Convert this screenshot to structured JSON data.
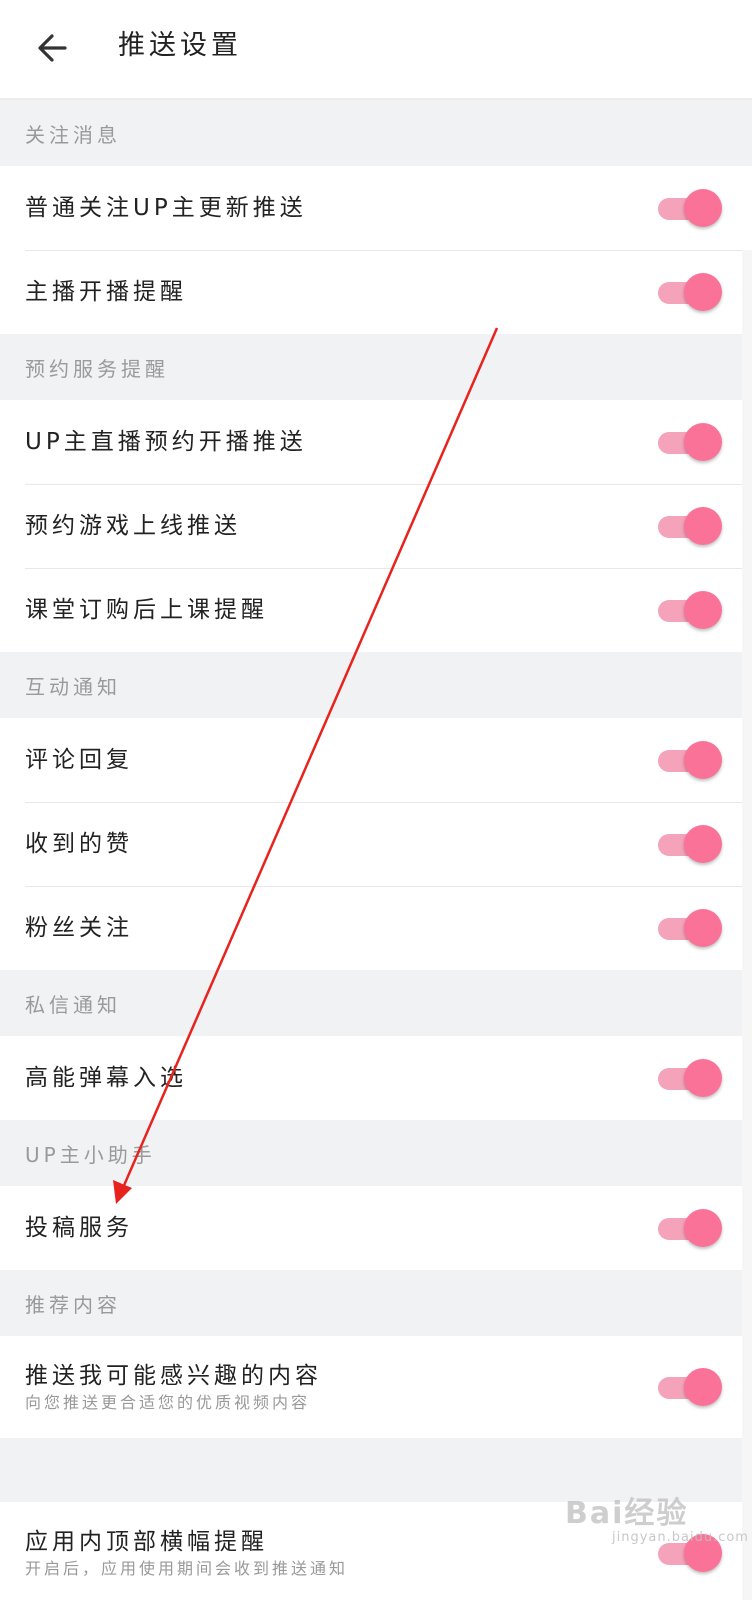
{
  "header": {
    "back_icon": "arrow-left-icon",
    "title": "推送设置"
  },
  "sections": [
    {
      "title": "关注消息",
      "items": [
        {
          "label": "普通关注UP主更新推送",
          "enabled": true
        },
        {
          "label": "主播开播提醒",
          "enabled": true
        }
      ]
    },
    {
      "title": "预约服务提醒",
      "items": [
        {
          "label": "UP主直播预约开播推送",
          "enabled": true
        },
        {
          "label": "预约游戏上线推送",
          "enabled": true
        },
        {
          "label": "课堂订购后上课提醒",
          "enabled": true
        }
      ]
    },
    {
      "title": "互动通知",
      "items": [
        {
          "label": "评论回复",
          "enabled": true
        },
        {
          "label": "收到的赞",
          "enabled": true
        },
        {
          "label": "粉丝关注",
          "enabled": true
        }
      ]
    },
    {
      "title": "私信通知",
      "items": [
        {
          "label": "高能弹幕入选",
          "enabled": true
        }
      ]
    },
    {
      "title": "UP主小助手",
      "items": [
        {
          "label": "投稿服务",
          "enabled": true
        }
      ]
    },
    {
      "title": "推荐内容",
      "items": [
        {
          "label": "推送我可能感兴趣的内容",
          "sublabel": "向您推送更合适您的优质视频内容",
          "enabled": true
        }
      ]
    }
  ],
  "extra_item": {
    "label": "应用内顶部横幅提醒",
    "sublabel": "开启后，应用使用期间会收到推送通知",
    "enabled": true
  },
  "colors": {
    "accent": "#fb7299",
    "toggle_track": "#f4a3ba",
    "section_bg": "#f1f2f4",
    "annotation_arrow": "#e8231e"
  },
  "watermark": {
    "text": "Bai经验",
    "sub": "jingyan.baidu.com"
  }
}
